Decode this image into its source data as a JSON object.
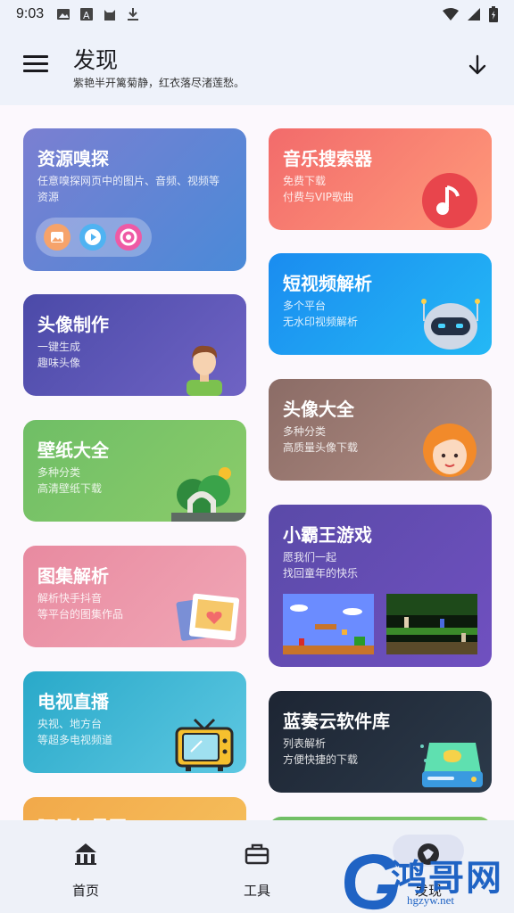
{
  "status": {
    "time": "9:03"
  },
  "header": {
    "title": "发现",
    "subtitle": "紫艳半开篱菊静，红衣落尽渚莲愁。"
  },
  "cards": [
    {
      "title": "资源嗅探",
      "lines": [
        "任意嗅探网页中的图片、音频、视频等",
        "资源"
      ],
      "color1": "#7b7fd1",
      "color2": "#4a8ad8",
      "icon": "media-sniff-icons"
    },
    {
      "title": "音乐搜索器",
      "lines": [
        "免费下载",
        "付费与VIP歌曲"
      ],
      "color1": "#f26b6b",
      "color2": "#ff9a7a",
      "icon": "music-note-icon"
    },
    {
      "title": "头像制作",
      "lines": [
        "一键生成",
        "趣味头像"
      ],
      "color1": "#4b4aa8",
      "color2": "#6f63c4",
      "icon": "boy-avatar-icon"
    },
    {
      "title": "短视频解析",
      "lines": [
        "多个平台",
        "无水印视频解析"
      ],
      "color1": "#1a8cf0",
      "color2": "#24b8f5",
      "icon": "robot-icon"
    },
    {
      "title": "壁纸大全",
      "lines": [
        "多种分类",
        "高清壁纸下载"
      ],
      "color1": "#6fbe66",
      "color2": "#8bcc6a",
      "icon": "garden-gate-icon"
    },
    {
      "title": "头像大全",
      "lines": [
        "多种分类",
        "高质量头像下载"
      ],
      "color1": "#8b6c66",
      "color2": "#b08c82",
      "icon": "girl-avatar-icon"
    },
    {
      "title": "图集解析",
      "lines": [
        "解析快手抖音",
        "等平台的图集作品"
      ],
      "color1": "#e88aa0",
      "color2": "#f1a7b6",
      "icon": "photo-stack-icon"
    },
    {
      "title": "小霸王游戏",
      "lines": [
        "愿我们一起",
        "找回童年的快乐"
      ],
      "color1": "#5a4aa8",
      "color2": "#7050c0",
      "icon": "game-screenshots"
    },
    {
      "title": "电视直播",
      "lines": [
        "央视、地方台",
        "等超多电视频道"
      ],
      "color1": "#29a9c9",
      "color2": "#5ec8e2",
      "icon": "tv-icon"
    },
    {
      "title": "蓝奏云软件库",
      "lines": [
        "列表解析",
        "方便快捷的下载"
      ],
      "color1": "#1d2533",
      "color2": "#2c3a4a",
      "icon": "hard-drive-icon"
    },
    {
      "title": "阿里矢量图",
      "lines": [],
      "color1": "#f2a94a",
      "color2": "#f6c25e",
      "icon": ""
    }
  ],
  "nav": [
    {
      "label": "首页",
      "icon": "home-icon"
    },
    {
      "label": "工具",
      "icon": "toolbox-icon"
    },
    {
      "label": "发现",
      "icon": "explore-icon"
    }
  ],
  "watermark": {
    "text": "鸿哥网",
    "url": "hgzyw.net"
  }
}
